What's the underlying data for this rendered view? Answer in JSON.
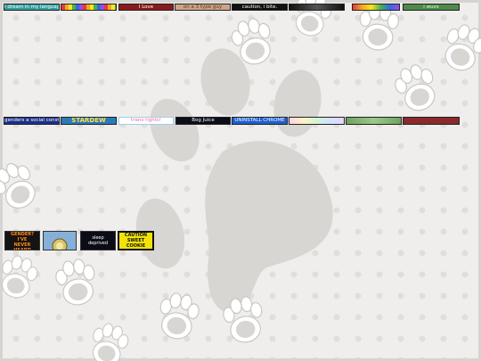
{
  "colors": {
    "background": "#efeeec",
    "dots": "#e0dedb",
    "paw_gray": "#d8d6d2",
    "paw_white": "#ffffff"
  },
  "decorations": {
    "big_paw": "paw-print-icon",
    "small_paws": "paw-print-icon"
  },
  "buttons_row1": [
    {
      "label": "I dream in my language",
      "bg": "#2f9e9c",
      "fg": "#ffffff"
    },
    {
      "label": "",
      "bg": "rainbow-crayons",
      "fg": "#ffffff"
    },
    {
      "label": "I Love",
      "bg": "#8a1b1b",
      "fg": "#ffffff"
    },
    {
      "label": "on a 3 type guy",
      "bg": "#caa58a",
      "fg": "#6b2c14"
    },
    {
      "label": "caution, i bite.",
      "bg": "#111111",
      "fg": "#ffffff"
    },
    {
      "label": "",
      "bg": "#1a1a1a",
      "fg": "#dddddd"
    },
    {
      "label": "",
      "bg": "rainbow-wave",
      "fg": "#ffffff"
    },
    {
      "label": "i wuvs",
      "bg": "#4d8a4a",
      "fg": "#e8ffe0"
    }
  ],
  "buttons_row2": [
    {
      "label": "genders a social construct",
      "bg": "#1b2f8a",
      "fg": "#ffffff"
    },
    {
      "label": "STARDEW",
      "bg": "#2a7ab8",
      "fg": "#ffe14a"
    },
    {
      "label": "trans rights!",
      "bg": "#ffffff",
      "fg": "#e86aa0"
    },
    {
      "label": "Bog Juice",
      "bg": "#0d0d1a",
      "fg": "#ffffff"
    },
    {
      "label": "UNINSTALL CHROME",
      "bg": "#1e5fd1",
      "fg": "#ffffff"
    },
    {
      "label": "",
      "bg": "pastel",
      "fg": "#7a4aa8"
    },
    {
      "label": "",
      "bg": "#7fb26f",
      "fg": "#ffffff"
    },
    {
      "label": "",
      "bg": "#8a2a2a",
      "fg": "#f0d0d0"
    }
  ],
  "stamps": [
    {
      "label": "GENDER? I'VE\nNEVER HEARD\nOF IT",
      "bg": "#141414",
      "fg": "#ff8a1a"
    },
    {
      "label": "",
      "bg": "#86b0d8",
      "fg": "#3a3a1a"
    },
    {
      "label": "sleep\ndeprived",
      "bg": "#0c0c16",
      "fg": "#ffffff"
    },
    {
      "label": "CAUTION\nSWEET\nCOOKIE",
      "bg": "#f2e20a",
      "fg": "#111111"
    }
  ]
}
